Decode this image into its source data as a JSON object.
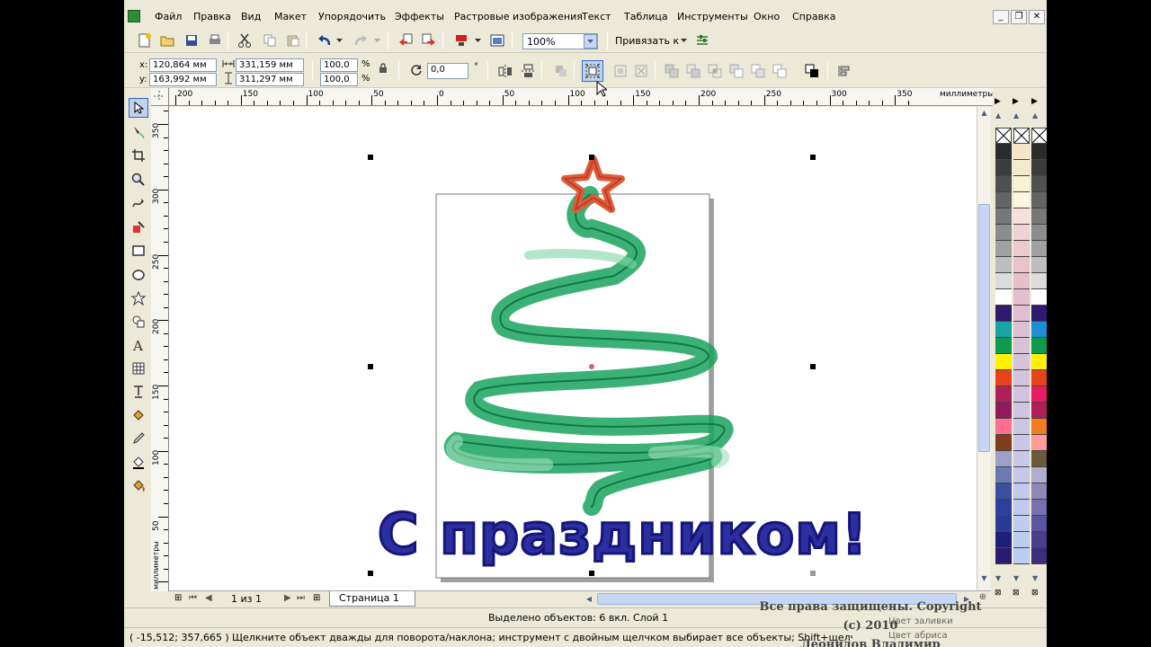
{
  "menu": [
    "Файл",
    "Правка",
    "Вид",
    "Макет",
    "Упорядочить",
    "Эффекты",
    "Растровые изображения",
    "Текст",
    "Таблица",
    "Инструменты",
    "Окно",
    "Справка"
  ],
  "window_buttons": {
    "minimize": "_",
    "restore": "❐",
    "close": "✕"
  },
  "toolbar": {
    "zoom_value": "100%",
    "snap_label": "Привязать к"
  },
  "property_bar": {
    "x_label": "x:",
    "x_value": "120,864 мм",
    "y_label": "y:",
    "y_value": "163,992 мм",
    "width_value": "331,159 мм",
    "height_value": "311,297 мм",
    "scale_x": "100,0",
    "scale_y": "100,0",
    "percent": "%",
    "rotation": "0,0",
    "degree": "°"
  },
  "ruler": {
    "unit": "миллиметры",
    "h_ticks": [
      "200",
      "150",
      "100",
      "50",
      "0",
      "50",
      "100",
      "150",
      "200",
      "250",
      "300",
      "350"
    ],
    "v_ticks": [
      "350",
      "300",
      "250",
      "200",
      "150",
      "100",
      "50"
    ],
    "v_unit": "миллиметры"
  },
  "canvas": {
    "greeting_text": "С праздником!"
  },
  "page_nav": {
    "page_count": "1 из 1",
    "page_tab": "Страница 1"
  },
  "status": {
    "selection": "Выделено объектов: 6 вкл. Слой 1",
    "coords": "( -15,512; 357,665 )",
    "hint": "Щелкните объект дважды для поворота/наклона; инструмент с двойным щелчком выбирает все объекты; Shift+щелчок - выбор на...",
    "fill_label": "Цвет заливки",
    "outline_label": "Цвет абриса"
  },
  "watermark": {
    "line1": "Все права защищены. Copyright (c) 2010",
    "line2": "Леонидов Владимир Владимирович"
  },
  "palette_colors": {
    "main": [
      "#2b2b2b",
      "#3c3c3c",
      "#505050",
      "#646464",
      "#787878",
      "#8c8c8c",
      "#a0a0a0",
      "#bebebe",
      "#dcdcdc",
      "#ffffff",
      "#2e1a6e",
      "#19a3a3",
      "#0e9b4e",
      "#fff200",
      "#e8421b",
      "#b01f5c",
      "#8f1a5e",
      "#ff6f91",
      "#7f3c1e",
      "#9aa0c8",
      "#6c7ab4",
      "#3b4ea0",
      "#2e3fa0",
      "#293a95",
      "#1f1f7a",
      "#2a1a70"
    ],
    "tint": [
      "#f5e6c8",
      "#f2ead0",
      "#f7f1d6",
      "#fbf6dd",
      "#f4e1dd",
      "#f0d2d5",
      "#ecc9cf",
      "#e9c2cb",
      "#e6c0cc",
      "#e3bfce",
      "#e0bfd1",
      "#dcc0d4",
      "#d9c1d7",
      "#d6c2da",
      "#d4c3dd",
      "#d1c4e0",
      "#cfc5e2",
      "#ccc6e4",
      "#cac7e6",
      "#c8c8e8",
      "#c6c9ea",
      "#c4caec",
      "#c2cbee",
      "#c0ccf0",
      "#beccf1",
      "#bccdf2"
    ],
    "right": [
      "#2b2b2b",
      "#3c3c3c",
      "#505050",
      "#646464",
      "#787878",
      "#8c8c8c",
      "#a0a0a0",
      "#bebebe",
      "#dcdcdc",
      "#ffffff",
      "#2e1a6e",
      "#1a8fd6",
      "#0e9b4e",
      "#fff200",
      "#e8421b",
      "#e81b63",
      "#b01f5c",
      "#f47c20",
      "#ff9b9b",
      "#6b5a3a",
      "#b0aecf",
      "#8e87b8",
      "#7a6fb0",
      "#5b54a0",
      "#4a3f8c",
      "#3b2f7a"
    ]
  }
}
